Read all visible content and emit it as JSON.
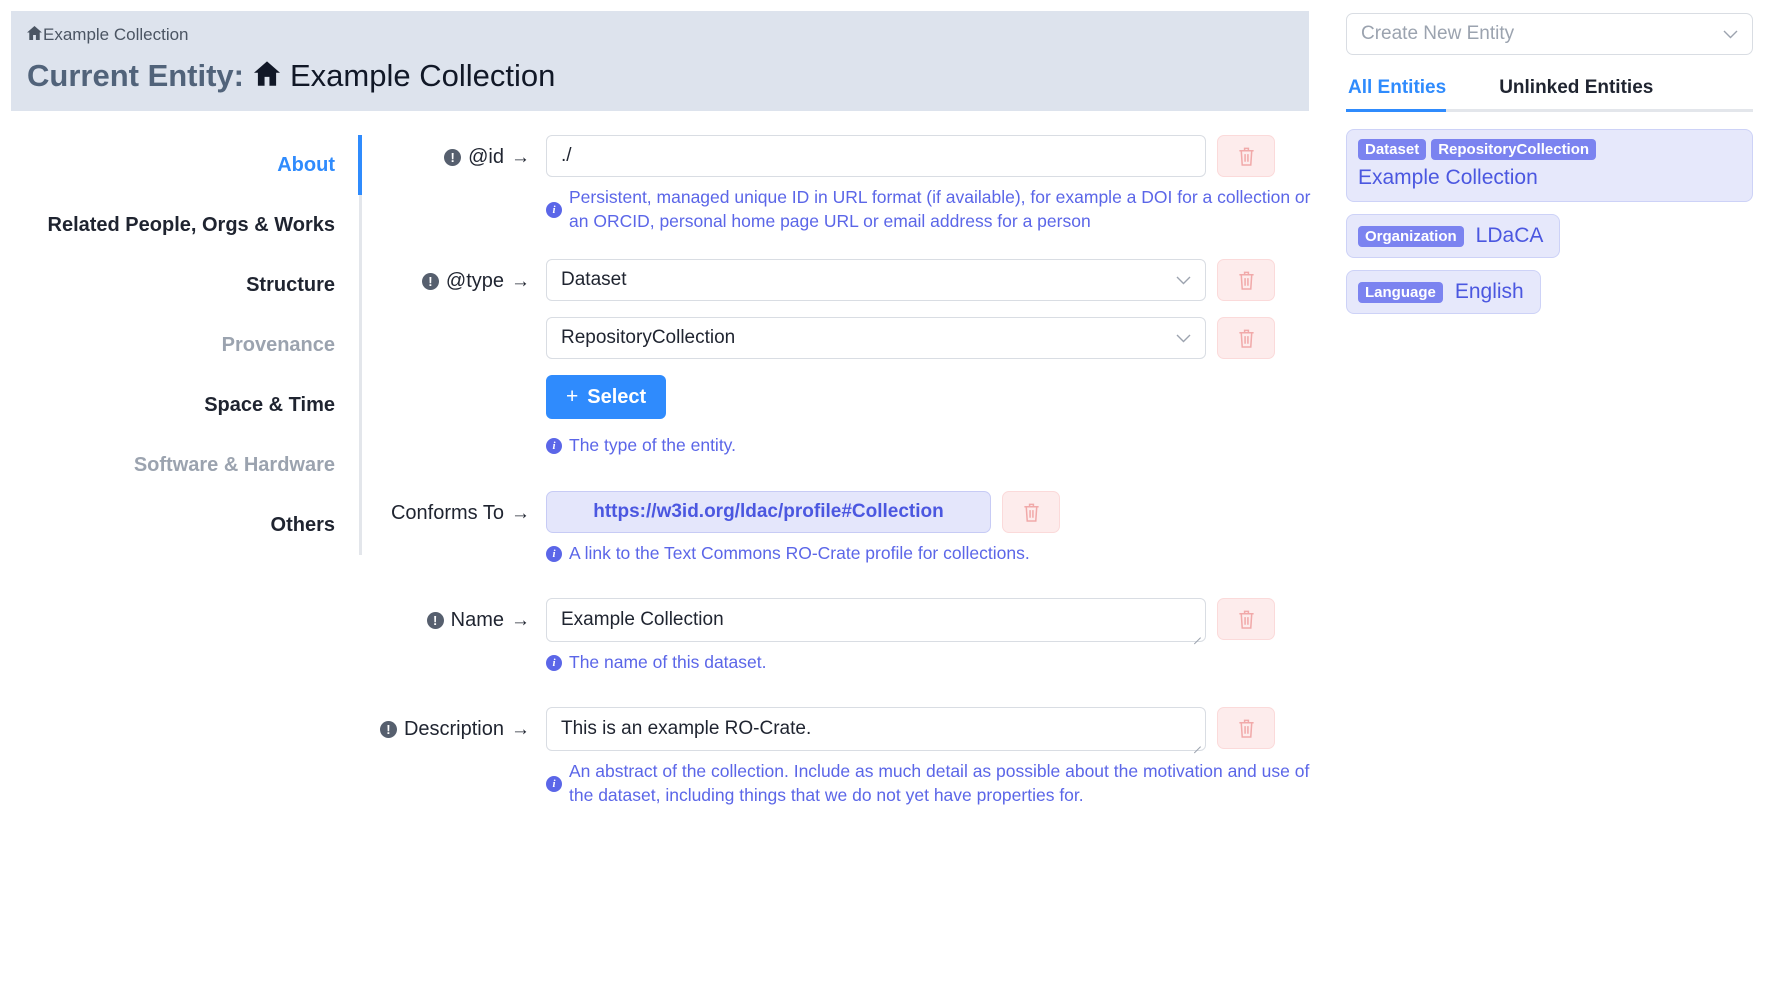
{
  "header": {
    "breadcrumb_icon": "home-icon",
    "breadcrumb_text": "Example Collection",
    "current_entity_label": "Current Entity:",
    "current_entity_icon": "home-icon",
    "current_entity_name": "Example Collection"
  },
  "nav": {
    "items": [
      {
        "label": "About",
        "state": "active"
      },
      {
        "label": "Related People, Orgs & Works",
        "state": "normal"
      },
      {
        "label": "Structure",
        "state": "normal"
      },
      {
        "label": "Provenance",
        "state": "muted"
      },
      {
        "label": "Space & Time",
        "state": "normal"
      },
      {
        "label": "Software & Hardware",
        "state": "muted"
      },
      {
        "label": "Others",
        "state": "normal"
      }
    ]
  },
  "form": {
    "id_field": {
      "label": "@id",
      "arrow": "→",
      "value": "./",
      "help": "Persistent, managed unique ID in URL format (if available), for example a DOI for a collection or an ORCID, personal home page URL or email address for a person"
    },
    "type_field": {
      "label": "@type",
      "arrow": "→",
      "value_1": "Dataset",
      "value_2": "RepositoryCollection",
      "select_button": "Select",
      "plus": "+",
      "help": "The type of the entity."
    },
    "conforms_to": {
      "label": "Conforms To",
      "arrow": "→",
      "value": "https://w3id.org/ldac/profile#Collection",
      "help": "A link to the Text Commons RO-Crate profile for collections."
    },
    "name_field": {
      "label": "Name",
      "arrow": "→",
      "value": "Example Collection",
      "help": "The name of this dataset."
    },
    "description_field": {
      "label": "Description",
      "arrow": "→",
      "value": "This is an example RO-Crate.",
      "help": "An abstract of the collection. Include as much detail as possible about the motivation and use of the dataset, including things that we do not yet have properties for."
    },
    "delete_icon": "trash-icon",
    "required_icon": "exclamation-circle-icon",
    "info_icon": "info-circle-icon"
  },
  "right_panel": {
    "create_entity_placeholder": "Create New Entity",
    "chevron_icon": "chevron-down-icon",
    "tabs": [
      {
        "label": "All Entities",
        "active": true
      },
      {
        "label": "Unlinked Entities",
        "active": false
      }
    ],
    "entities": [
      {
        "badges": [
          "Dataset",
          "RepositoryCollection"
        ],
        "name": "Example Collection",
        "layout": "stacked"
      },
      {
        "badges": [
          "Organization"
        ],
        "name": "LDaCA",
        "layout": "inline"
      },
      {
        "badges": [
          "Language"
        ],
        "name": "English",
        "layout": "inline"
      }
    ]
  },
  "colors": {
    "accent_blue": "#2f8bfd",
    "indigo": "#5b66e8",
    "badge_indigo": "#7b83f0",
    "header_bg": "#dde3ed",
    "danger_bg": "#fdecec",
    "danger_fg": "#f1a9a9"
  }
}
